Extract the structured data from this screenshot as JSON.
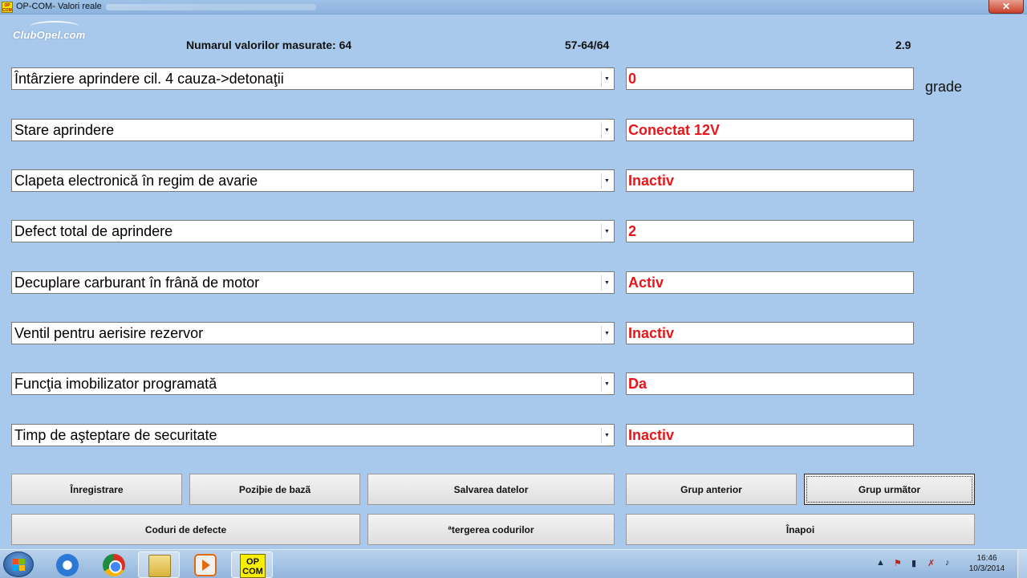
{
  "window": {
    "title": "OP-COM- Valori reale",
    "close_glyph": "✕",
    "icon_text": "OP COM"
  },
  "logo": {
    "text": "ClubOpel.com"
  },
  "header": {
    "count_label": "Numarul valorilor masurate: 64",
    "range": "57-64/64",
    "version": "2.9"
  },
  "rows": [
    {
      "label": "Întârziere aprindere cil. 4 cauza->detonaţii",
      "value": "0",
      "unit": "grade"
    },
    {
      "label": "Stare aprindere",
      "value": "Conectat 12V"
    },
    {
      "label": "Clapeta electronică în regim de avarie",
      "value": "Inactiv"
    },
    {
      "label": "Defect total de aprindere",
      "value": "2"
    },
    {
      "label": "Decuplare carburant în frână de motor",
      "value": "Activ"
    },
    {
      "label": "Ventil pentru aerisire rezervor",
      "value": "Inactiv"
    },
    {
      "label": "Funcţia imobilizator programată",
      "value": "Da"
    },
    {
      "label": "Timp de aşteptare de securitate",
      "value": "Inactiv"
    }
  ],
  "buttons": {
    "inregistrare": "Înregistrare",
    "pozitie": "Poziþie de bazã",
    "salvare": "Salvarea datelor",
    "grup_anterior": "Grup anterior",
    "grup_urmator": "Grup urmãtor",
    "coduri": "Coduri de defecte",
    "stergere": "ªtergerea codurilor",
    "inapoi": "Înapoi"
  },
  "taskbar": {
    "opcom_label_line1": "OP",
    "opcom_label_line2": "COM",
    "time": "16:46",
    "date": "10/3/2014"
  },
  "colors": {
    "background": "#a9c9ec",
    "value_text": "#e8161a"
  },
  "icons": [
    "windows-start-icon",
    "internet-explorer-icon",
    "chrome-icon",
    "file-explorer-icon",
    "media-player-icon",
    "opcom-icon"
  ]
}
